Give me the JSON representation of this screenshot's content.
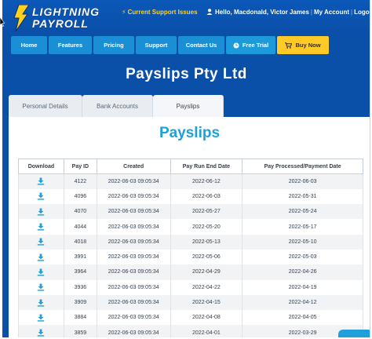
{
  "header": {
    "logo_line1": "LIGHTNING",
    "logo_line2": "PAYROLL",
    "support_link": "Current Support Issues",
    "greeting": "Hello, Macdonald, Victor James",
    "my_account": "My Account",
    "logout": "Logout"
  },
  "nav": {
    "items": [
      "Home",
      "Features",
      "Pricing",
      "Support",
      "Contact Us",
      "Free Trial",
      "Buy Now"
    ]
  },
  "page": {
    "heading": "Payslips Pty Ltd"
  },
  "tabs": [
    "Personal Details",
    "Bank Accounts",
    "Payslips"
  ],
  "active_tab": "Payslips",
  "panel": {
    "title": "Payslips"
  },
  "table": {
    "headers": [
      "Download",
      "Pay ID",
      "Created",
      "Pay Run End Date",
      "Pay Processed/Payment Date"
    ],
    "rows": [
      {
        "pay_id": "4122",
        "created": "2022-06-03 09:05:34",
        "end_date": "2022-06-12",
        "payment_date": "2022-06-03"
      },
      {
        "pay_id": "4096",
        "created": "2022-06-03 09:05:34",
        "end_date": "2022-06-03",
        "payment_date": "2022-05-31"
      },
      {
        "pay_id": "4070",
        "created": "2022-06-03 09:05:34",
        "end_date": "2022-05-27",
        "payment_date": "2022-05-24"
      },
      {
        "pay_id": "4044",
        "created": "2022-06-03 09:05:34",
        "end_date": "2022-05-20",
        "payment_date": "2022-05-17"
      },
      {
        "pay_id": "4018",
        "created": "2022-06-03 09:05:34",
        "end_date": "2022-05-13",
        "payment_date": "2022-05-10"
      },
      {
        "pay_id": "3991",
        "created": "2022-06-03 09:05:34",
        "end_date": "2022-05-06",
        "payment_date": "2022-05-03"
      },
      {
        "pay_id": "3964",
        "created": "2022-06-03 09:05:34",
        "end_date": "2022-04-29",
        "payment_date": "2022-04-26"
      },
      {
        "pay_id": "3936",
        "created": "2022-06-03 09:05:34",
        "end_date": "2022-04-22",
        "payment_date": "2022-04-19"
      },
      {
        "pay_id": "3909",
        "created": "2022-06-03 09:05:34",
        "end_date": "2022-04-15",
        "payment_date": "2022-04-12"
      },
      {
        "pay_id": "3884",
        "created": "2022-06-03 09:05:34",
        "end_date": "2022-04-08",
        "payment_date": "2022-04-05"
      },
      {
        "pay_id": "3859",
        "created": "2022-06-03 09:05:34",
        "end_date": "2022-04-01",
        "payment_date": "2022-03-29"
      }
    ]
  },
  "colors": {
    "brand_blue": "#0a4fa8",
    "nav_blue": "#1b8fd6",
    "accent_yellow": "#ffc928",
    "title_cyan": "#1fa0da"
  },
  "icons": {
    "download": "download-icon",
    "support": "lightning-bolt-icon",
    "user": "person-icon",
    "trial": "clock-icon",
    "buy": "cart-icon"
  }
}
